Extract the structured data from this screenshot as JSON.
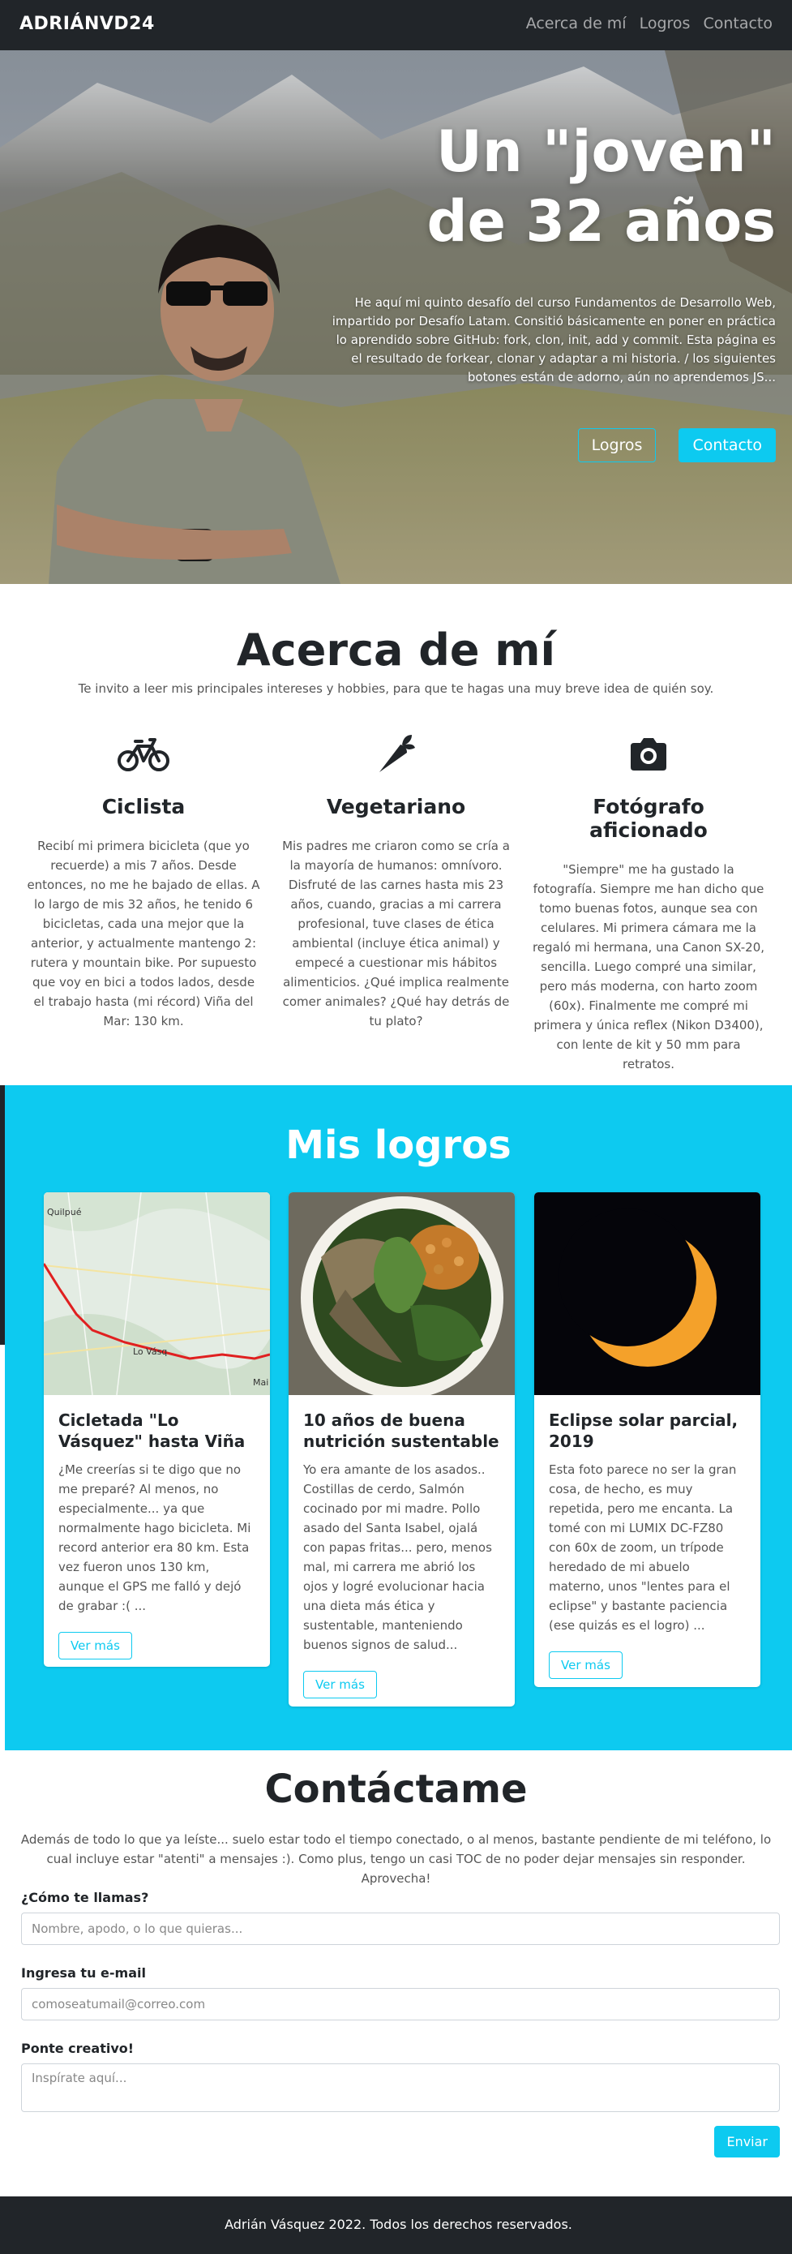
{
  "navbar": {
    "brand": "ADRIÁNVD24",
    "links": [
      "Acerca de mí",
      "Logros",
      "Contacto"
    ]
  },
  "hero": {
    "title": "Un \"joven\" de 32 años",
    "text": "He aquí mi quinto desafío del curso Fundamentos de Desarrollo Web, impartido por Desafío Latam. Consitió básicamente en poner en práctica lo aprendido sobre GitHub: fork, clon, init, add y commit. Esta página es el resultado de forkear, clonar y adaptar a mi historia. / los siguientes botones están de adorno, aún no aprendemos JS...",
    "btn_logros": "Logros",
    "btn_contacto": "Contacto"
  },
  "about": {
    "title": "Acerca de mí",
    "lead": "Te invito a leer mis principales intereses y hobbies, para que te hagas una muy breve idea de quién soy.",
    "features": [
      {
        "icon": "bicycle-icon",
        "title": "Ciclista",
        "text": "Recibí mi primera bicicleta (que yo recuerde) a mis 7 años. Desde entonces, no me he bajado de ellas. A lo largo de mis 32 años, he tenido 6 bicicletas, cada una mejor que la anterior, y actualmente mantengo 2: rutera y mountain bike. Por supuesto que voy en bici a todos lados, desde el trabajo hasta (mi récord) Viña del Mar: 130 km."
      },
      {
        "icon": "carrot-icon",
        "title": "Vegetariano",
        "text": "Mis padres me criaron como se cría a la mayoría de humanos: omnívoro. Disfruté de las carnes hasta mis 23 años, cuando, gracias a mi carrera profesional, tuve clases de ética ambiental (incluye ética animal) y empecé a cuestionar mis hábitos alimenticios. ¿Qué implica realmente comer animales? ¿Qué hay detrás de tu plato?"
      },
      {
        "icon": "camera-icon",
        "title": "Fotógrafo aficionado",
        "text": "\"Siempre\" me ha gustado la fotografía. Siempre me han dicho que tomo buenas fotos, aunque sea con celulares. Mi primera cámara me la regaló mi hermana, una Canon SX-20, sencilla. Luego compré una similar, pero más moderna, con harto zoom (60x). Finalmente me compré mi primera y única reflex (Nikon D3400), con lente de kit y 50 mm para retratos."
      }
    ]
  },
  "logros": {
    "title": "Mis logros",
    "cards": [
      {
        "title": "Cicletada \"Lo Vásquez\" hasta Viña",
        "text": "¿Me creerías si te digo que no me preparé? Al menos, no especialmente... ya que normalmente hago bicicleta. Mi record anterior era 80 km. Esta vez fueron unos 130 km, aunque el GPS me falló y dejó de grabar :( ...",
        "button": "Ver más",
        "map_labels": [
          "Quilpué",
          "Lo Vásq",
          "Mai"
        ]
      },
      {
        "title": "10 años de buena nutrición sustentable",
        "text": "Yo era amante de los asados.. Costillas de cerdo, Salmón cocinado por mi madre. Pollo asado del Santa Isabel, ojalá con papas fritas... pero, menos mal, mi carrera me abrió los ojos y logré evolucionar hacia una dieta más ética y sustentable, manteniendo buenos signos de salud...",
        "button": "Ver más"
      },
      {
        "title": "Eclipse solar parcial, 2019",
        "text": "Esta foto parece no ser la gran cosa, de hecho, es muy repetida, pero me encanta. La tomé con mi LUMIX DC-FZ80 con 60x de zoom, un trípode heredado de mi abuelo materno, unos \"lentes para el eclipse\" y bastante paciencia (ese quizás es el logro) ...",
        "button": "Ver más"
      }
    ]
  },
  "contact": {
    "title": "Contáctame",
    "lead": "Además de todo lo que ya leíste... suelo estar todo el tiempo conectado, o al menos, bastante pendiente de mi teléfono, lo cual incluye estar \"atenti\" a mensajes :). Como plus, tengo un casi TOC de no poder dejar mensajes sin responder. Aprovecha!",
    "name_label": "¿Cómo te llamas?",
    "name_placeholder": "Nombre, apodo, o lo que quieras...",
    "email_label": "Ingresa tu e-mail",
    "email_placeholder": "comoseatumail@correo.com",
    "message_label": "Ponte creativo!",
    "message_placeholder": "Inspírate aquí...",
    "submit": "Enviar"
  },
  "footer": {
    "text": "Adrián Vásquez 2022. Todos los derechos reservados."
  },
  "colors": {
    "dark": "#212529",
    "accent": "#0dcaf0",
    "text_muted": "#555555"
  }
}
